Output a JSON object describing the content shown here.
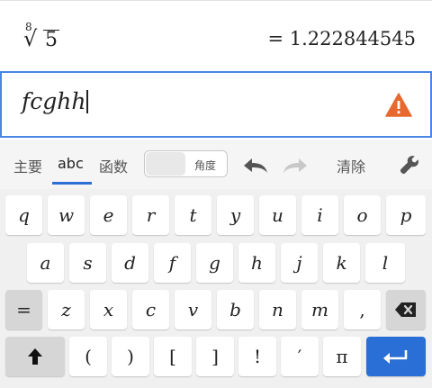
{
  "result": {
    "index": "8",
    "radical": "√",
    "radicand": "5",
    "value": "= 1.222844545"
  },
  "input": {
    "text": "fcghh",
    "warning_icon": "warning-triangle-icon",
    "warning_color": "#e8692f"
  },
  "toolbar": {
    "tabs": [
      "主要",
      "abc",
      "函数"
    ],
    "active_tab": "abc",
    "toggle_label": "角度",
    "clear_label": "清除",
    "icons": [
      "undo-icon",
      "redo-icon",
      "wrench-icon"
    ],
    "accent_color": "#2a6fd6"
  },
  "keyboard": {
    "row1": [
      "q",
      "w",
      "e",
      "r",
      "t",
      "y",
      "u",
      "i",
      "o",
      "p"
    ],
    "row2": [
      "a",
      "s",
      "d",
      "f",
      "g",
      "h",
      "j",
      "k",
      "l"
    ],
    "row3": [
      "=",
      "z",
      "x",
      "c",
      "v",
      "b",
      "n",
      "m",
      ","
    ],
    "row4": [
      "(",
      ")",
      "[",
      "]",
      "!",
      "′",
      "π"
    ],
    "icons": [
      "backspace-icon",
      "shift-icon",
      "enter-icon"
    ]
  }
}
